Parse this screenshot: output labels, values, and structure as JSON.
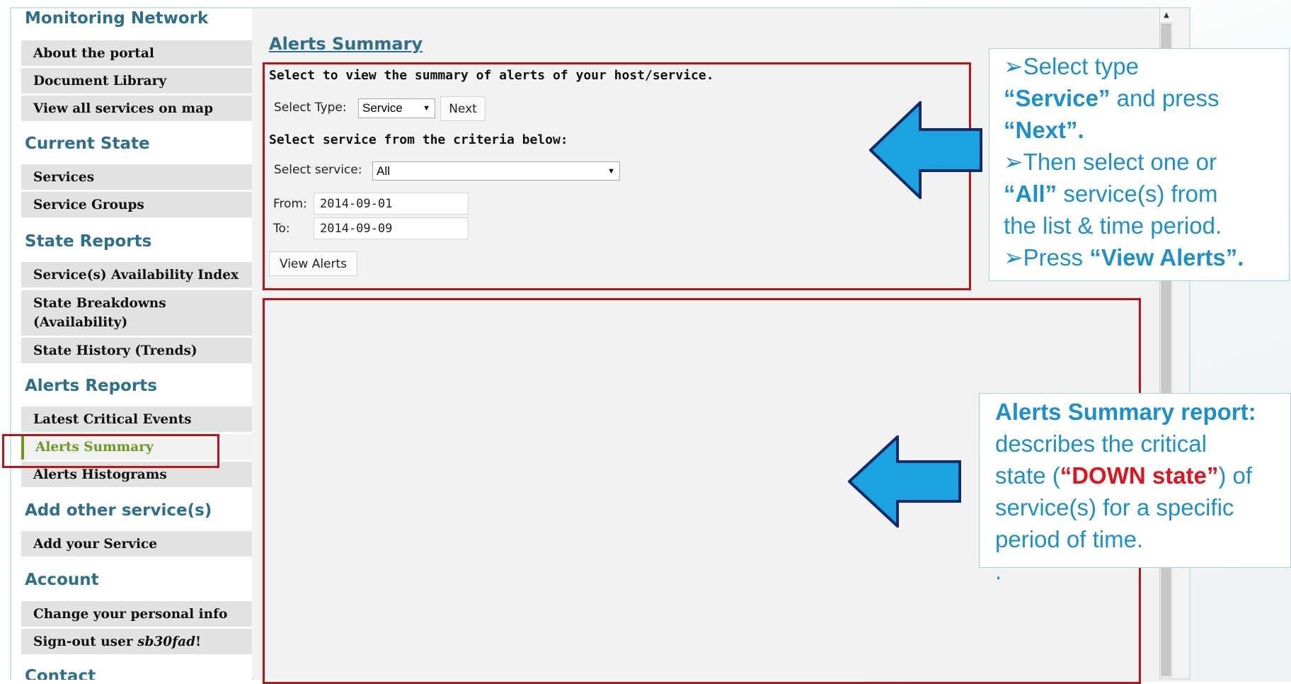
{
  "sidebar": {
    "sections": {
      "monitoring": "Monitoring Network",
      "current_state": "Current State",
      "state_reports": "State Reports",
      "alerts_reports": "Alerts Reports",
      "add_other": "Add other service(s)",
      "account": "Account",
      "contact": "Contact"
    },
    "items": {
      "about": "About the portal",
      "doc_library": "Document Library",
      "view_map": "View all services on map",
      "services": "Services",
      "service_groups": "Service Groups",
      "availability_index": "Service(s) Availability Index",
      "state_breakdowns_1": "State Breakdowns",
      "state_breakdowns_2": "(Availability)",
      "state_history": "State History (Trends)",
      "latest_critical": "Latest Critical Events",
      "alerts_summary": "Alerts Summary",
      "alerts_histograms": "Alerts Histograms",
      "add_service": "Add your Service",
      "change_info": "Change your personal info",
      "signout_prefix": "Sign-out user ",
      "signout_user": "sb30fad",
      "signout_suffix": "!"
    }
  },
  "main": {
    "title": "Alerts Summary",
    "instruction": "Select to view the summary of alerts of your host/service.",
    "select_type_label": "Select Type:",
    "select_type_value": "Service",
    "next_button": "Next",
    "criteria_heading": "Select service from the criteria below:",
    "select_service_label": "Select service:",
    "select_service_value": "All",
    "from_label": "From:",
    "from_value": "2014-09-01",
    "to_label": "To:",
    "to_value": "2014-09-09",
    "view_alerts_button": "View Alerts"
  },
  "callout1": {
    "l1_bullet": "➢",
    "l1": "Select type",
    "l2_bold": "“Service”",
    "l2": " and press",
    "l3_bold": "“Next”.",
    "l4_bullet": "➢",
    "l4": "Then select one or",
    "l5_bold": "“All”",
    "l5": " service(s) from",
    "l6": "the list & time period.",
    "l7_bullet": "➢",
    "l7": "Press ",
    "l7_bold": "“View Alerts”."
  },
  "callout2": {
    "heading": "Alerts Summary report:",
    "l2": "describes the critical",
    "l3_pre": "state (",
    "l3_red": "“DOWN state”",
    "l3_post": ") of",
    "l4": "service(s) for a specific",
    "l5": "period of time.",
    "l6": "."
  },
  "colors": {
    "heading_teal": "#2d6f8c",
    "active_green": "#6a9a1e",
    "highlight_red": "#b8141a",
    "callout_blue": "#1d8fcf",
    "arrow_blue": "#1aa3e0"
  },
  "icons": {
    "scroll_up": "scroll-up-arrow-icon",
    "dropdown": "chevron-down-icon",
    "pointer_arrows": "left-arrow-icon"
  }
}
